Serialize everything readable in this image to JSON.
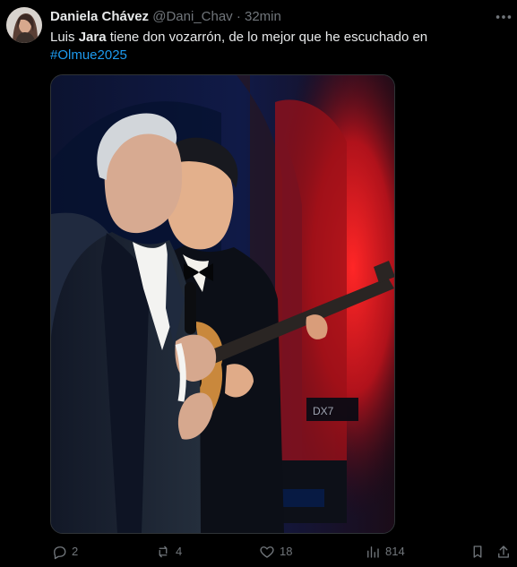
{
  "tweet": {
    "author_name": "Daniela Chávez",
    "author_handle": "@Dani_Chav",
    "separator": "·",
    "time": "32min",
    "text_before": "Luis ",
    "text_bold": "Jara",
    "text_after": " tiene don vozarrón, de lo mejor que he escuchado en",
    "hashtag": "#Olmue2025"
  },
  "media": {
    "description_icons": [
      "singer-with-microphone",
      "guitarist-with-acoustic-guitar"
    ],
    "brand_text": "DX7"
  },
  "actions": {
    "reply_count": "2",
    "repost_count": "4",
    "like_count": "18",
    "view_count": "814"
  },
  "colors": {
    "background": "#000000",
    "text": "#e7e9ea",
    "muted": "#71767b",
    "accent": "#1d9bf0"
  }
}
